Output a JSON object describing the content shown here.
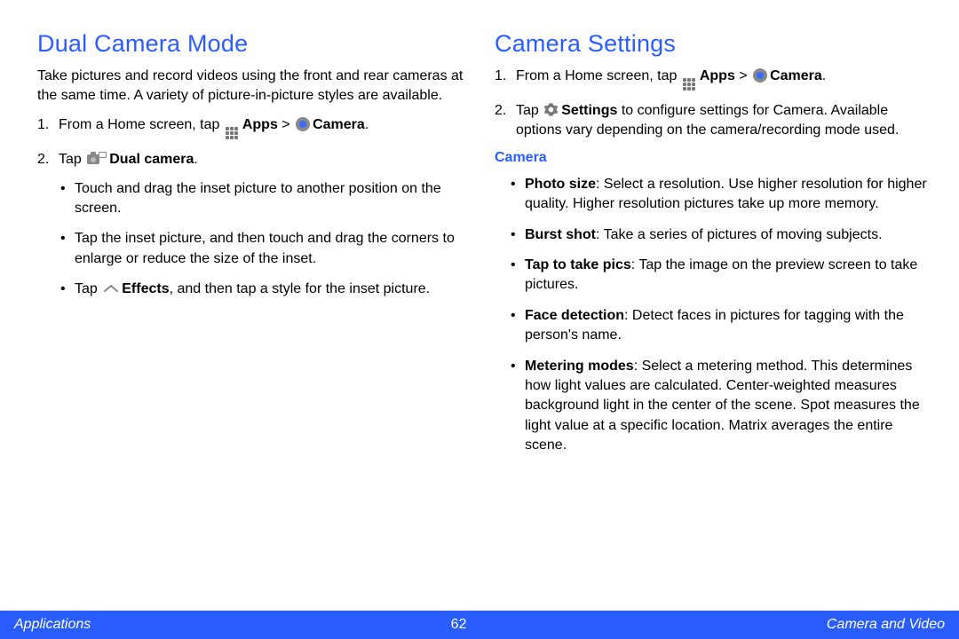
{
  "left": {
    "heading": "Dual Camera Mode",
    "intro": "Take pictures and record videos using the front and rear cameras at the same time. A variety of picture-in-picture styles are available.",
    "step1_a": "From a Home screen, tap ",
    "step1_b": "Apps",
    "step1_c": " > ",
    "step1_d": "Camera",
    "step1_e": ".",
    "step2_a": "Tap ",
    "step2_b": "Dual camera",
    "step2_c": ".",
    "bul1": "Touch and drag the inset picture to another position on the screen.",
    "bul2": "Tap the inset picture, and then touch and drag the corners to enlarge or reduce the size of the inset.",
    "bul3_a": "Tap ",
    "bul3_b": "Effects",
    "bul3_c": ", and then tap a style for the inset picture."
  },
  "right": {
    "heading": "Camera Settings",
    "step1_a": "From a Home screen, tap ",
    "step1_b": "Apps",
    "step1_c": " > ",
    "step1_d": "Camera",
    "step1_e": ".",
    "step2_a": "Tap ",
    "step2_b": "Settings",
    "step2_c": " to configure settings for Camera. Available options vary depending on the camera/recording mode used.",
    "subhead": "Camera",
    "b1_a": "Photo size",
    "b1_b": ": Select a resolution. Use higher resolution for higher quality. Higher resolution pictures take up more memory.",
    "b2_a": "Burst shot",
    "b2_b": ": Take a series of pictures of moving subjects.",
    "b3_a": "Tap to take pics",
    "b3_b": ": Tap the image on the preview screen to take pictures.",
    "b4_a": "Face detection",
    "b4_b": ": Detect faces in pictures for tagging with the person's name.",
    "b5_a": "Metering modes",
    "b5_b": ": Select a metering method. This determines how light values are calculated. Center-weighted measures background light in the center of the scene. Spot measures the light value at a specific location. Matrix averages the entire scene."
  },
  "footer": {
    "left": "Applications",
    "center": "62",
    "right": "Camera and Video"
  }
}
